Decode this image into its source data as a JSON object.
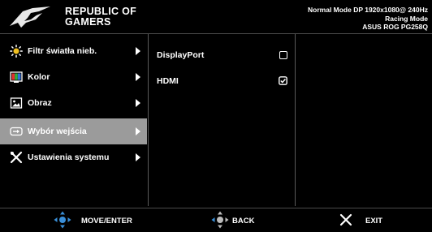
{
  "header": {
    "brand_line1": "REPUBLIC OF",
    "brand_line2": "GAMERS",
    "status_line1": "Normal Mode DP 1920x1080@ 240Hz",
    "status_line2": "Racing Mode",
    "status_line3": "ASUS ROG PG258Q"
  },
  "menu": {
    "items": [
      {
        "label": "Filtr światła nieb.",
        "icon": "bluelight-icon"
      },
      {
        "label": "Kolor",
        "icon": "color-icon"
      },
      {
        "label": "Obraz",
        "icon": "image-icon"
      },
      {
        "label": "Wybór wejścia",
        "icon": "input-icon",
        "active": true
      },
      {
        "label": "Ustawienia systemu",
        "icon": "tools-icon"
      }
    ]
  },
  "inputs": {
    "options": [
      {
        "label": "DisplayPort",
        "selected": false
      },
      {
        "label": "HDMI",
        "selected": true
      }
    ]
  },
  "footer": {
    "move_label": "MOVE/ENTER",
    "back_label": "BACK",
    "exit_label": "EXIT"
  },
  "colors": {
    "background": "#000000",
    "active_row": "#9b9b9b",
    "divider": "#5a5a5a",
    "joystick": "#3a8fd8"
  }
}
